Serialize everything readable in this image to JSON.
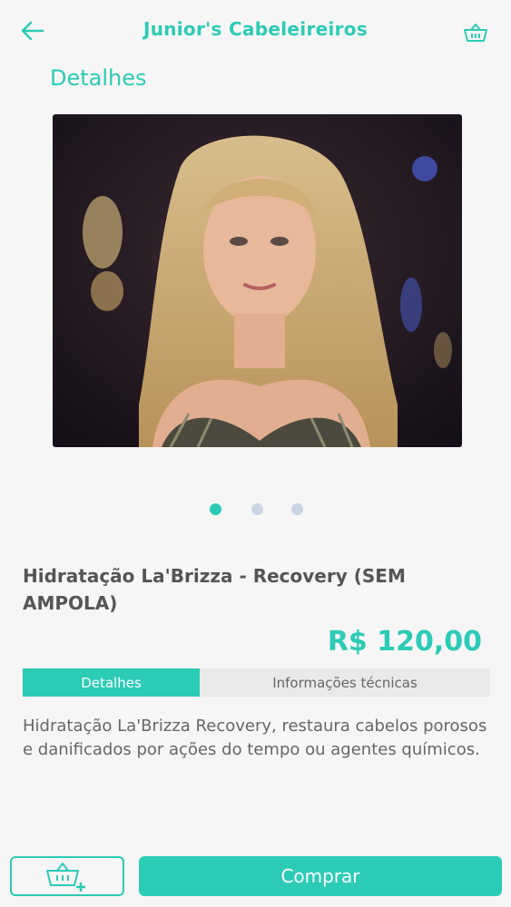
{
  "header": {
    "title": "Junior's Cabeleireiros",
    "back_icon": "arrow-left-icon",
    "cart_icon": "basket-icon"
  },
  "section_title": "Detalhes",
  "carousel": {
    "slide_count": 3,
    "active_index": 0,
    "image_description": "portrait photo"
  },
  "product": {
    "name": "Hidratação La'Brizza - Recovery (SEM AMPOLA)",
    "price": "R$ 120,00"
  },
  "tabs": [
    {
      "label": "Detalhes",
      "active": true
    },
    {
      "label": "Informações técnicas",
      "active": false
    }
  ],
  "description": "Hidratação La'Brizza Recovery, restaura cabelos porosos e danificados por ações do tempo ou agentes químicos.",
  "actions": {
    "add_to_cart_icon": "basket-plus-icon",
    "buy_label": "Comprar"
  },
  "colors": {
    "accent": "#2ccbb5",
    "background": "#f6f6f7",
    "text": "#555555"
  }
}
